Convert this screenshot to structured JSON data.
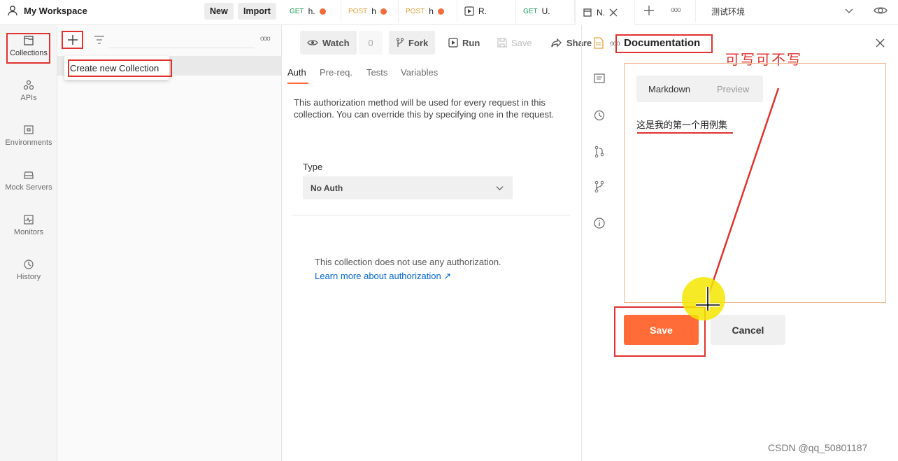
{
  "header": {
    "workspace": "My Workspace",
    "new_label": "New",
    "import_label": "Import",
    "tabs": [
      {
        "method": "GET",
        "name": "h.",
        "dirty": true
      },
      {
        "method": "POST",
        "name": "h",
        "dirty": true
      },
      {
        "method": "POST",
        "name": "h",
        "dirty": true
      },
      {
        "method": "",
        "name": "R.",
        "dirty": false
      },
      {
        "method": "GET",
        "name": "U.",
        "dirty": false
      },
      {
        "method": "",
        "name": "N.",
        "dirty": false
      }
    ],
    "more_label": "ooo",
    "environment": "测试环境"
  },
  "sidebar": {
    "items": [
      {
        "label": "Collections",
        "icon": "collections-icon"
      },
      {
        "label": "APIs",
        "icon": "apis-icon"
      },
      {
        "label": "Environments",
        "icon": "environments-icon"
      },
      {
        "label": "Mock Servers",
        "icon": "mock-servers-icon"
      },
      {
        "label": "Monitors",
        "icon": "monitors-icon"
      },
      {
        "label": "History",
        "icon": "history-icon"
      }
    ]
  },
  "collections_panel": {
    "more_label": "ooo",
    "tooltip": "Create new Collection"
  },
  "toolbar": {
    "watch_label": "Watch",
    "watch_count": "0",
    "fork_label": "Fork",
    "run_label": "Run",
    "save_label": "Save",
    "share_label": "Share",
    "more_label": "ooo"
  },
  "auth": {
    "tabs": [
      "Auth",
      "Pre-req.",
      "Tests",
      "Variables"
    ],
    "description": "This authorization method will be used for every request in this collection. You can override this by specifying one in the request.",
    "type_label": "Type",
    "type_value": "No Auth",
    "no_auth_text": "This collection does not use any authorization.",
    "learn_more": "Learn more about authorization ↗"
  },
  "documentation": {
    "title": "Documentation",
    "annotation": "可写可不写",
    "markdown_tab": "Markdown",
    "preview_tab": "Preview",
    "content": "这是我的第一个用例集",
    "save_label": "Save",
    "cancel_label": "Cancel"
  },
  "watermark": "CSDN @qq_50801187",
  "colors": {
    "accent": "#ff6c37",
    "annotation_red": "#e0332f",
    "link_blue": "#0265d2"
  }
}
